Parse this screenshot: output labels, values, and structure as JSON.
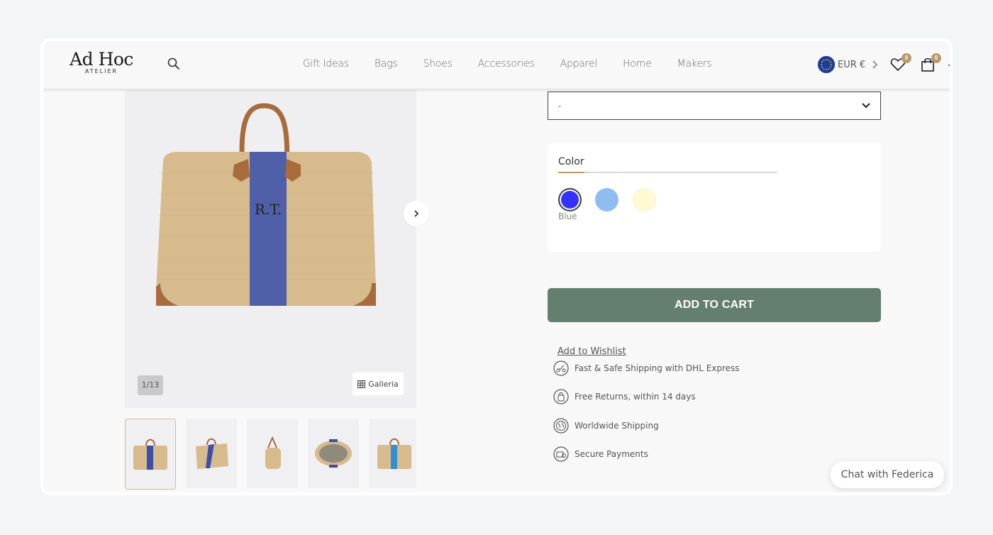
{
  "header": {
    "logo_main": "Ad Hoc",
    "logo_sub": "ATELIER",
    "nav": [
      {
        "label": "Gift Ideas"
      },
      {
        "label": "Bags"
      },
      {
        "label": "Shoes"
      },
      {
        "label": "Accessories"
      },
      {
        "label": "Apparel"
      },
      {
        "label": "Home"
      },
      {
        "label": "Makers"
      }
    ],
    "currency": "EUR €",
    "wishlist_count": "0",
    "cart_count": "0"
  },
  "gallery": {
    "counter": "1/13",
    "galleria_label": "Galleria",
    "monogram": "R.T.",
    "thumbnails": [
      {
        "view": "front",
        "stripe_color": "#3b4fa8",
        "active": true
      },
      {
        "view": "angle",
        "stripe_color": "#3b4fa8"
      },
      {
        "view": "side",
        "stripe_color": "#3b4fa8"
      },
      {
        "view": "top-open",
        "stripe_color": "#3b4fa8"
      },
      {
        "view": "front-light-blue",
        "stripe_color": "#2f8fd0"
      }
    ]
  },
  "product": {
    "select_value": "-",
    "color_title": "Color",
    "colors": [
      {
        "name": "Blue",
        "hex": "#3333ff",
        "selected": true
      },
      {
        "name": "Light Blue",
        "hex": "#8fbdf2"
      },
      {
        "name": "Cream",
        "hex": "#fffbd0"
      }
    ],
    "selected_color_label": "Blue",
    "add_to_cart": "ADD TO CART",
    "wishlist": "Add to Wishlist",
    "features": [
      {
        "icon": "delivery-scooter-icon",
        "text": "Fast & Safe Shipping with DHL Express"
      },
      {
        "icon": "shopping-bag-return-icon",
        "text": "Free Returns, within 14 days"
      },
      {
        "icon": "globe-icon",
        "text": "Worldwide Shipping"
      },
      {
        "icon": "secure-payment-icon",
        "text": "Secure Payments"
      }
    ],
    "accent_color": "#647f6f"
  },
  "chat": {
    "label": "Chat with Federica"
  }
}
